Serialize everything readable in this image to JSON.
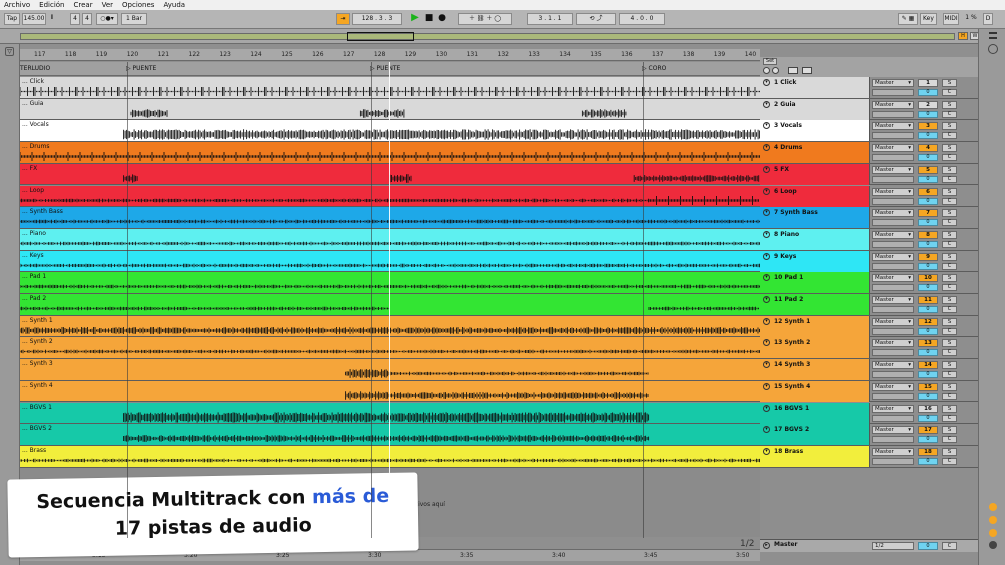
{
  "menu": [
    "Archivo",
    "Edición",
    "Crear",
    "Ver",
    "Opciones",
    "Ayuda"
  ],
  "control": {
    "tap": "Tap",
    "tempo": "145.00",
    "sig_num": "4",
    "sig_den": "4",
    "metro": "1 Bar",
    "position": "128 . 3 . 3",
    "loop_start": "3 . 1 . 1",
    "loop_len": "4 . 0 . 0",
    "key": "Key",
    "midi": "MIDI",
    "cpu": "1 %",
    "d_label": "D"
  },
  "overview": {
    "hot_h": "H",
    "w": "W"
  },
  "ruler": {
    "bars": [
      "117",
      "118",
      "119",
      "120",
      "121",
      "122",
      "123",
      "124",
      "125",
      "126",
      "127",
      "128",
      "129",
      "130",
      "131",
      "132",
      "133",
      "134",
      "135",
      "136",
      "137",
      "138",
      "139",
      "140"
    ],
    "set_label": "Set"
  },
  "locators": [
    {
      "label": "TERLUDIO"
    },
    {
      "label": "PUENTE"
    },
    {
      "label": "PUENTE"
    },
    {
      "label": "CORO"
    }
  ],
  "tracks": [
    {
      "lane": "Click",
      "name": "1 Click",
      "color": "#d9d9d9",
      "out": "Master",
      "num": "1",
      "s": "S",
      "vol": "0",
      "c": "C",
      "numColor": "#d9d9d9"
    },
    {
      "lane": "Guia",
      "name": "2 Guia",
      "color": "#d9d9d9",
      "out": "Master",
      "num": "2",
      "s": "S",
      "vol": "0",
      "c": "C",
      "numColor": "#d9d9d9"
    },
    {
      "lane": "Vocals",
      "name": "3 Vocals",
      "color": "#ffffff",
      "out": "Master",
      "num": "3",
      "s": "S",
      "vol": "0",
      "c": "C",
      "numColor": "#f5a623"
    },
    {
      "lane": "Drums",
      "name": "4 Drums",
      "color": "#f07a1e",
      "out": "Master",
      "num": "4",
      "s": "S",
      "vol": "0",
      "c": "C",
      "numColor": "#f5a623"
    },
    {
      "lane": "FX",
      "name": "5 FX",
      "color": "#ef2b3c",
      "out": "Master",
      "num": "5",
      "s": "S",
      "vol": "0",
      "c": "C",
      "numColor": "#f5a623"
    },
    {
      "lane": "Loop",
      "name": "6 Loop",
      "color": "#ef2b3c",
      "out": "Master",
      "num": "6",
      "s": "S",
      "vol": "0",
      "c": "C",
      "numColor": "#f5a623"
    },
    {
      "lane": "Synth Bass",
      "name": "7 Synth Bass",
      "color": "#1ea8e8",
      "out": "Master",
      "num": "7",
      "s": "S",
      "vol": "0",
      "c": "C",
      "numColor": "#f5a623"
    },
    {
      "lane": "Piano",
      "name": "8 Piano",
      "color": "#5ef0f0",
      "out": "Master",
      "num": "8",
      "s": "S",
      "vol": "0",
      "c": "C",
      "numColor": "#f5a623"
    },
    {
      "lane": "Keys",
      "name": "9 Keys",
      "color": "#2ee6f5",
      "out": "Master",
      "num": "9",
      "s": "S",
      "vol": "0",
      "c": "C",
      "numColor": "#f5a623"
    },
    {
      "lane": "Pad 1",
      "name": "10 Pad 1",
      "color": "#33e533",
      "out": "Master",
      "num": "10",
      "s": "S",
      "vol": "0",
      "c": "C",
      "numColor": "#f5a623"
    },
    {
      "lane": "Pad 2",
      "name": "11 Pad 2",
      "color": "#33e533",
      "out": "Master",
      "num": "11",
      "s": "S",
      "vol": "0",
      "c": "C",
      "numColor": "#f5a623"
    },
    {
      "lane": "Synth 1",
      "name": "12 Synth 1",
      "color": "#f5a53a",
      "out": "Master",
      "num": "12",
      "s": "S",
      "vol": "0",
      "c": "C",
      "numColor": "#f5a623"
    },
    {
      "lane": "Synth 2",
      "name": "13 Synth 2",
      "color": "#f5a53a",
      "out": "Master",
      "num": "13",
      "s": "S",
      "vol": "0",
      "c": "C",
      "numColor": "#f5a623"
    },
    {
      "lane": "Synth 3",
      "name": "14 Synth 3",
      "color": "#f5a53a",
      "out": "Master",
      "num": "14",
      "s": "S",
      "vol": "0",
      "c": "C",
      "numColor": "#f5a623"
    },
    {
      "lane": "Synth 4",
      "name": "15 Synth 4",
      "color": "#f5a53a",
      "out": "Master",
      "num": "15",
      "s": "S",
      "vol": "0",
      "c": "C",
      "numColor": "#f5a623"
    },
    {
      "lane": "BGVS 1",
      "name": "16 BGVS 1",
      "color": "#16c9a8",
      "out": "Master",
      "num": "16",
      "s": "S",
      "vol": "0",
      "c": "C",
      "numColor": "#d9d9d9"
    },
    {
      "lane": "BGVS 2",
      "name": "17 BGVS 2",
      "color": "#16c9a8",
      "out": "Master",
      "num": "17",
      "s": "S",
      "vol": "0",
      "c": "C",
      "numColor": "#f5a623"
    },
    {
      "lane": "Brass",
      "name": "18 Brass",
      "color": "#f2ee3c",
      "out": "Master",
      "num": "18",
      "s": "S",
      "vol": "0",
      "c": "C",
      "numColor": "#f5a623"
    }
  ],
  "drop_hint": "...tivos aquí",
  "timeline": [
    "3:15",
    "3:20",
    "3:25",
    "3:30",
    "3:35",
    "3:40",
    "3:45",
    "3:50"
  ],
  "page_indicator": "1/2",
  "master": {
    "name": "Master",
    "out": "1/2",
    "vol": "0",
    "c": "C"
  },
  "caption": {
    "line1_plain": "Secuencia Multitrack con ",
    "line1_hl": "más de",
    "line2_hl": "17 pistas de audio"
  }
}
